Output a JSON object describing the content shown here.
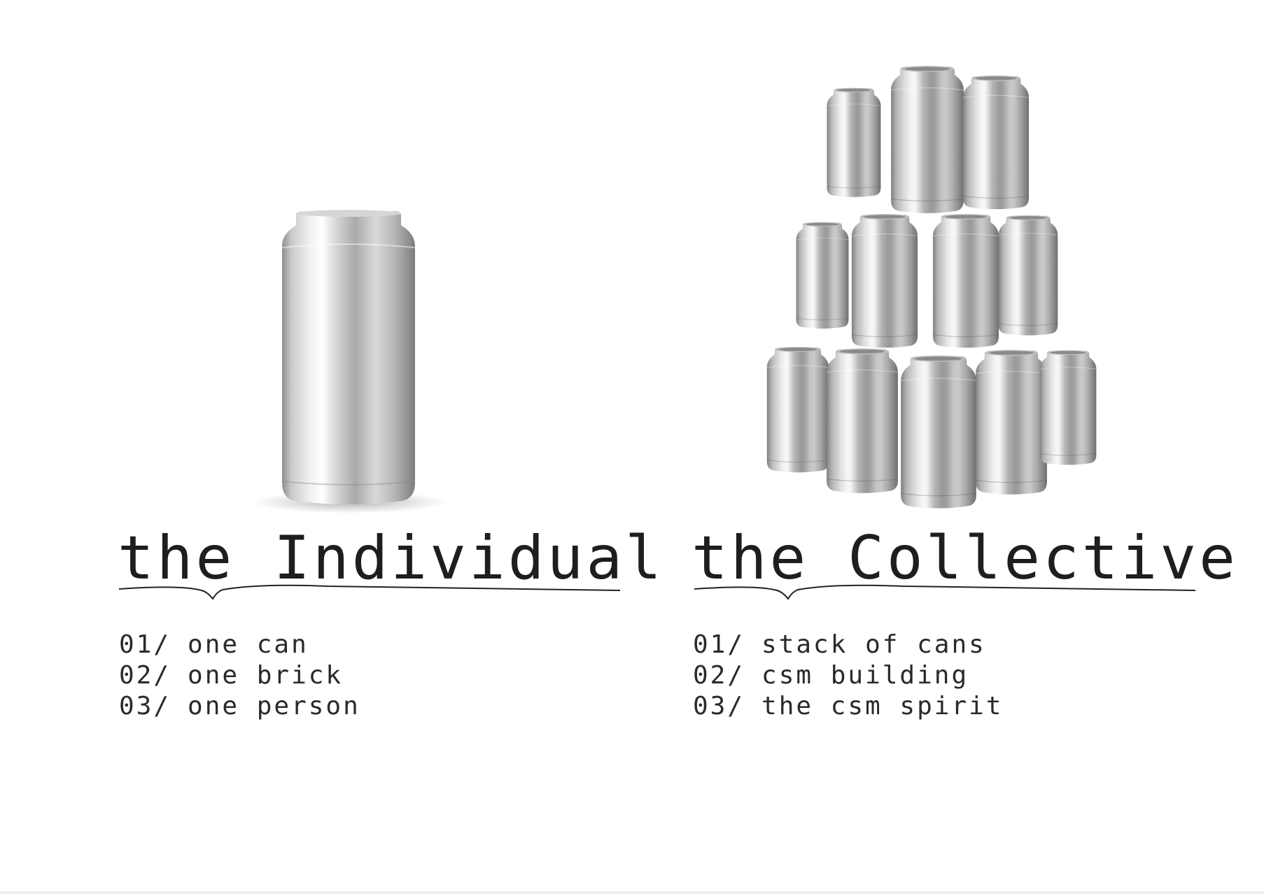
{
  "individual": {
    "title": "the Individual",
    "items": [
      {
        "num": "01/",
        "text": "one can"
      },
      {
        "num": "02/",
        "text": "one brick"
      },
      {
        "num": "03/",
        "text": "one person"
      }
    ]
  },
  "collective": {
    "title": "the Collective",
    "items": [
      {
        "num": "01/",
        "text": "stack of cans"
      },
      {
        "num": "02/",
        "text": "csm building"
      },
      {
        "num": "03/",
        "text": "the csm spirit"
      }
    ]
  },
  "colors": {
    "background": "#ffffff",
    "text": "#1e1e1e",
    "can_light": "#f4f4f4",
    "can_dark": "#9a9a9a"
  }
}
